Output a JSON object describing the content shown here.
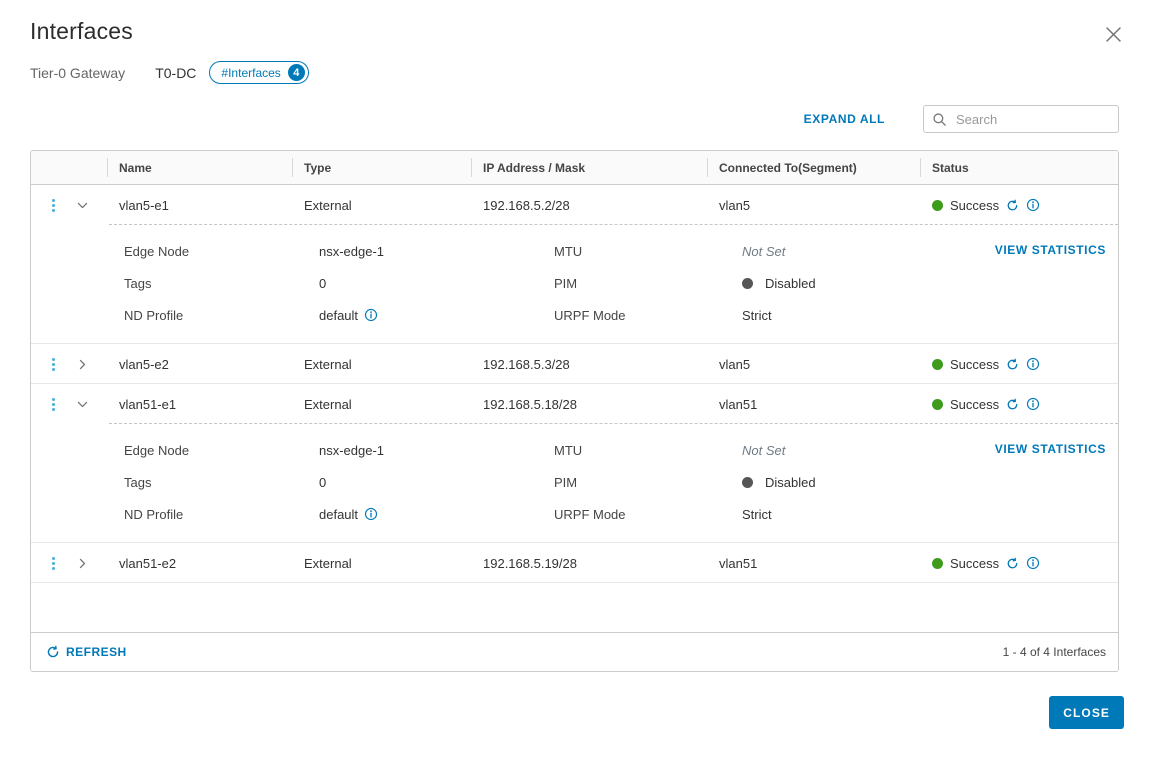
{
  "dialog": {
    "title": "Interfaces",
    "subtitle_label": "Tier-0 Gateway",
    "gateway_name": "T0-DC",
    "badge": {
      "label": "#Interfaces",
      "count": "4"
    },
    "close_label": "CLOSE"
  },
  "toolbar": {
    "expand_all": "EXPAND ALL",
    "search_placeholder": "Search",
    "search_value": ""
  },
  "table": {
    "columns": [
      "Name",
      "Type",
      "IP Address / Mask",
      "Connected To(Segment)",
      "Status"
    ],
    "rows": [
      {
        "name": "vlan5-e1",
        "type": "External",
        "ip": "192.168.5.2/28",
        "segment": "vlan5",
        "status": "Success",
        "expanded": true,
        "details": {
          "edge_node": "nsx-edge-1",
          "tags": "0",
          "nd_profile": "default",
          "mtu": "Not Set",
          "pim": "Disabled",
          "urpf": "Strict"
        }
      },
      {
        "name": "vlan5-e2",
        "type": "External",
        "ip": "192.168.5.3/28",
        "segment": "vlan5",
        "status": "Success",
        "expanded": false
      },
      {
        "name": "vlan51-e1",
        "type": "External",
        "ip": "192.168.5.18/28",
        "segment": "vlan51",
        "status": "Success",
        "expanded": true,
        "details": {
          "edge_node": "nsx-edge-1",
          "tags": "0",
          "nd_profile": "default",
          "mtu": "Not Set",
          "pim": "Disabled",
          "urpf": "Strict"
        }
      },
      {
        "name": "vlan51-e2",
        "type": "External",
        "ip": "192.168.5.19/28",
        "segment": "vlan51",
        "status": "Success",
        "expanded": false
      }
    ],
    "detail_labels": {
      "edge_node": "Edge Node",
      "tags": "Tags",
      "nd_profile": "ND Profile",
      "mtu": "MTU",
      "pim": "PIM",
      "urpf": "URPF Mode"
    },
    "view_statistics": "VIEW STATISTICS",
    "footer": {
      "refresh": "REFRESH",
      "pagination": "1 - 4 of 4 Interfaces"
    }
  },
  "icons": {
    "close": "x-mark",
    "search": "magnifier",
    "row_menu": "vertical-ellipsis",
    "expand": "chevron",
    "status_refresh": "refresh-arrow",
    "status_info": "info-circle",
    "success_dot": "filled-circle-green",
    "pim_disabled_dot": "filled-circle-gray"
  },
  "colors": {
    "accent": "#0079B8",
    "success": "#3E9B1C",
    "dots": "#49AFD9",
    "disabled-dot": "#565656"
  }
}
